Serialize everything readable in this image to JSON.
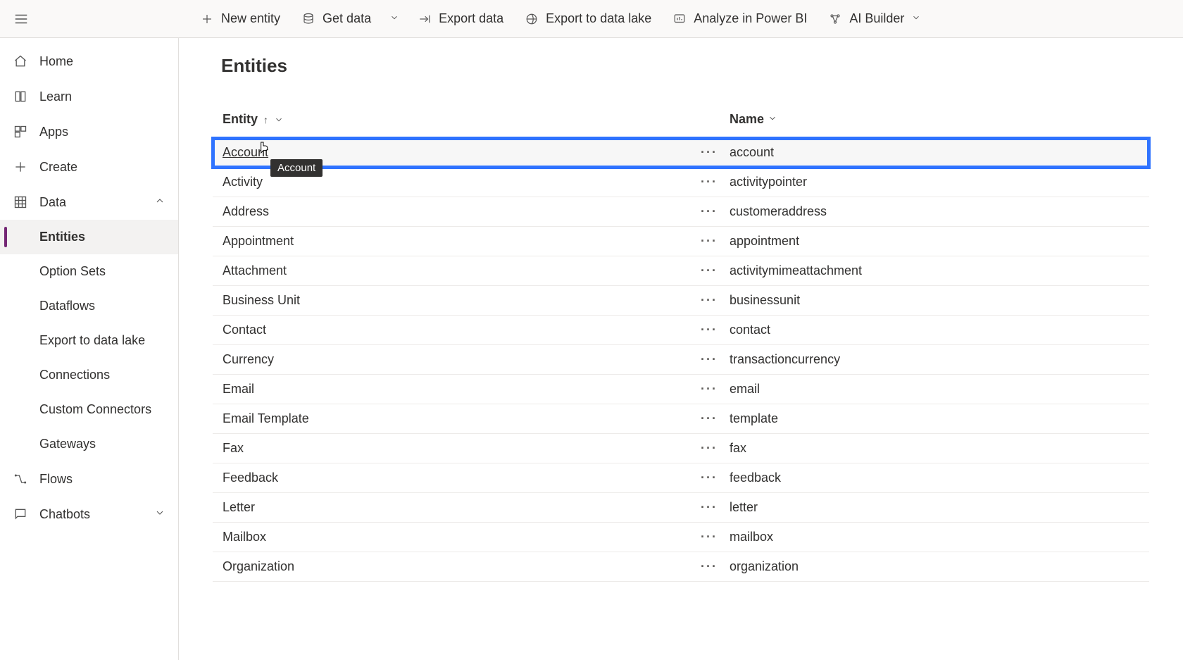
{
  "commands": {
    "new_entity": "New entity",
    "get_data": "Get data",
    "export_data": "Export data",
    "export_data_lake": "Export to data lake",
    "analyze_pbi": "Analyze in Power BI",
    "ai_builder": "AI Builder"
  },
  "sidebar": {
    "home": "Home",
    "learn": "Learn",
    "apps": "Apps",
    "create": "Create",
    "data": "Data",
    "data_children": {
      "entities": "Entities",
      "option_sets": "Option Sets",
      "dataflows": "Dataflows",
      "export_data_lake": "Export to data lake",
      "connections": "Connections",
      "custom_connectors": "Custom Connectors",
      "gateways": "Gateways"
    },
    "flows": "Flows",
    "chatbots": "Chatbots"
  },
  "page": {
    "title": "Entities",
    "col_entity": "Entity",
    "col_name": "Name"
  },
  "tooltip": {
    "text": "Account"
  },
  "rows": [
    {
      "entity": "Account",
      "name": "account",
      "selected": true
    },
    {
      "entity": "Activity",
      "name": "activitypointer",
      "selected": false
    },
    {
      "entity": "Address",
      "name": "customeraddress",
      "selected": false
    },
    {
      "entity": "Appointment",
      "name": "appointment",
      "selected": false
    },
    {
      "entity": "Attachment",
      "name": "activitymimeattachment",
      "selected": false
    },
    {
      "entity": "Business Unit",
      "name": "businessunit",
      "selected": false
    },
    {
      "entity": "Contact",
      "name": "contact",
      "selected": false
    },
    {
      "entity": "Currency",
      "name": "transactioncurrency",
      "selected": false
    },
    {
      "entity": "Email",
      "name": "email",
      "selected": false
    },
    {
      "entity": "Email Template",
      "name": "template",
      "selected": false
    },
    {
      "entity": "Fax",
      "name": "fax",
      "selected": false
    },
    {
      "entity": "Feedback",
      "name": "feedback",
      "selected": false
    },
    {
      "entity": "Letter",
      "name": "letter",
      "selected": false
    },
    {
      "entity": "Mailbox",
      "name": "mailbox",
      "selected": false
    },
    {
      "entity": "Organization",
      "name": "organization",
      "selected": false
    }
  ]
}
